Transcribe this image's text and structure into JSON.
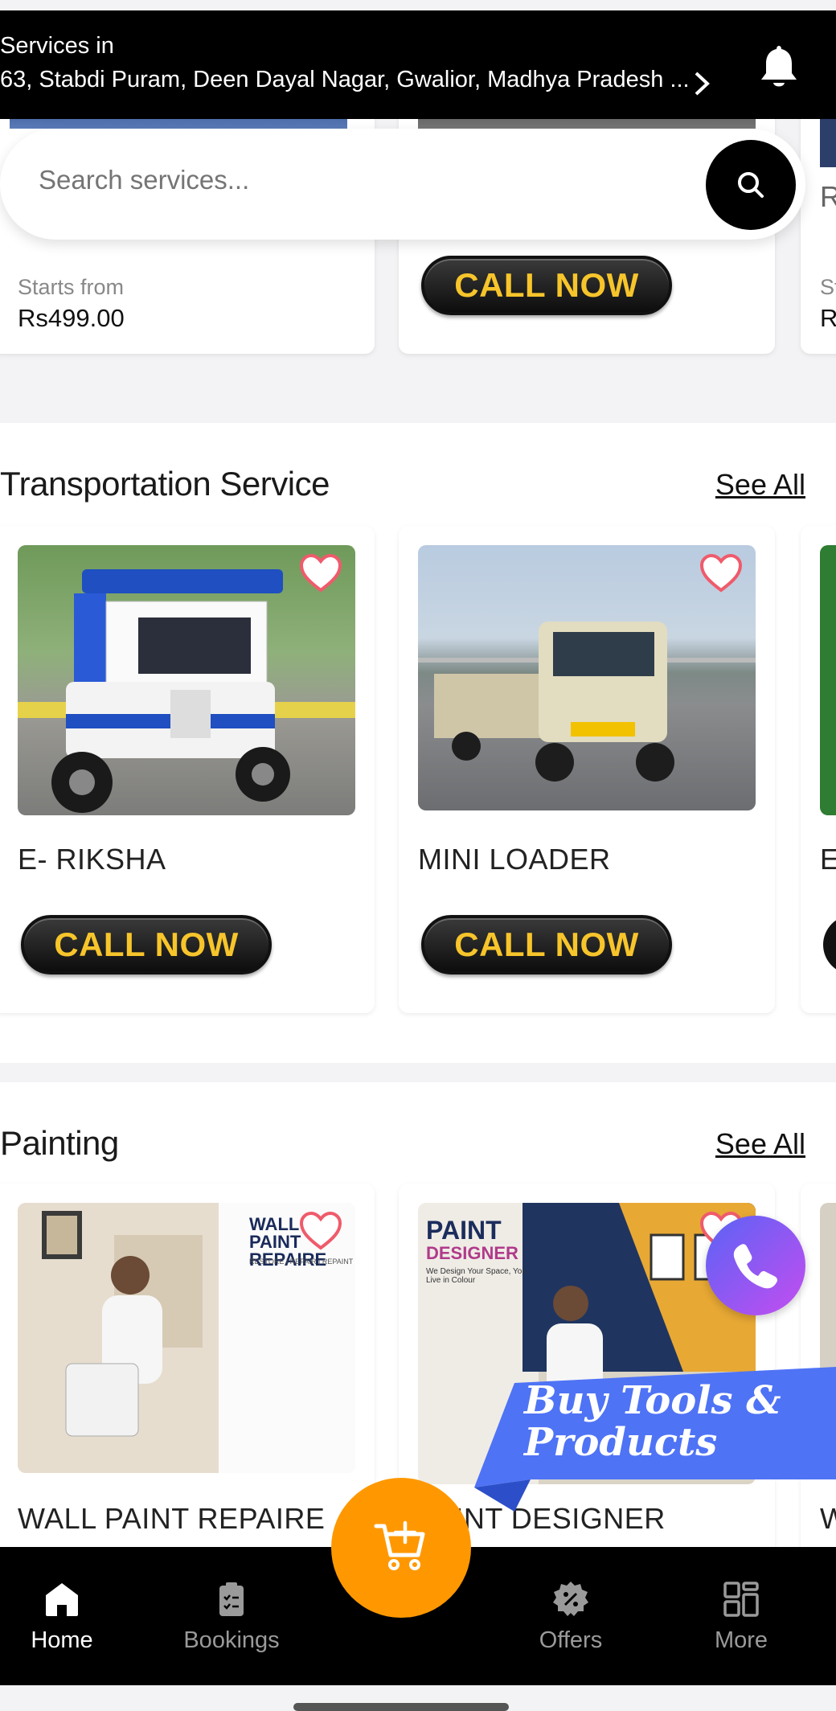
{
  "header": {
    "label": "Services in",
    "address": "63, Stabdi Puram, Deen Dayal Nagar, Gwalior, Madhya Pradesh ..."
  },
  "search": {
    "placeholder": "Search services..."
  },
  "top_section": {
    "cards": [
      {
        "starts_label": "Starts from",
        "price": "Rs499.00"
      },
      {
        "button": "CALL NOW"
      },
      {
        "starts_label": "St",
        "price": "R"
      }
    ]
  },
  "transportation": {
    "title": "Transportation Service",
    "see_all": "See All",
    "cards": [
      {
        "title": "E- RIKSHA",
        "button": "CALL NOW"
      },
      {
        "title": "MINI LOADER",
        "button": "CALL NOW"
      },
      {
        "title": "E"
      }
    ]
  },
  "painting": {
    "title": "Painting",
    "see_all": "See All",
    "cards": [
      {
        "title": "WALL PAINT REPAIRE",
        "poster_title": "WALL PAINT REPAIRE",
        "poster_sub": "RESTORE | REPAIR | REPAINT"
      },
      {
        "title": "PAINT DESIGNER",
        "poster_title": "PAINT",
        "poster_title2": "DESIGNER",
        "poster_sub": "We Design Your Space, You Live in Colour"
      },
      {
        "title": "W"
      }
    ]
  },
  "promo": {
    "text": "Buy Tools & Products"
  },
  "nav": {
    "items": [
      {
        "label": "Home",
        "icon": "home-icon"
      },
      {
        "label": "Bookings",
        "icon": "clipboard-icon"
      },
      {
        "label": "Offers",
        "icon": "offer-badge-icon"
      },
      {
        "label": "More",
        "icon": "grid-icon"
      }
    ]
  },
  "colors": {
    "accent": "#ff9800",
    "call_text": "#f7c52b",
    "promo_blue": "#4f73f5"
  }
}
